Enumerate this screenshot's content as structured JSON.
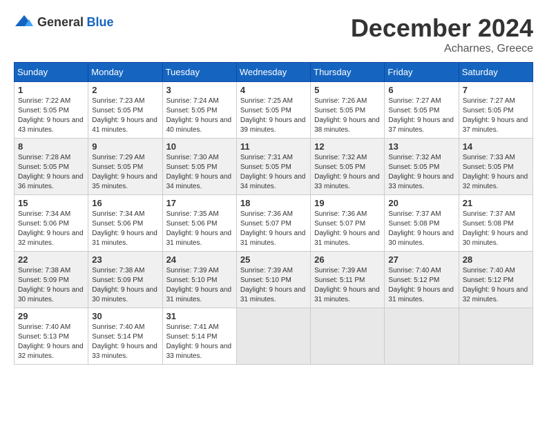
{
  "header": {
    "logo_general": "General",
    "logo_blue": "Blue",
    "month_title": "December 2024",
    "location": "Acharnes, Greece"
  },
  "columns": [
    "Sunday",
    "Monday",
    "Tuesday",
    "Wednesday",
    "Thursday",
    "Friday",
    "Saturday"
  ],
  "weeks": [
    [
      {
        "day": "1",
        "sunrise": "Sunrise: 7:22 AM",
        "sunset": "Sunset: 5:05 PM",
        "daylight": "Daylight: 9 hours and 43 minutes."
      },
      {
        "day": "2",
        "sunrise": "Sunrise: 7:23 AM",
        "sunset": "Sunset: 5:05 PM",
        "daylight": "Daylight: 9 hours and 41 minutes."
      },
      {
        "day": "3",
        "sunrise": "Sunrise: 7:24 AM",
        "sunset": "Sunset: 5:05 PM",
        "daylight": "Daylight: 9 hours and 40 minutes."
      },
      {
        "day": "4",
        "sunrise": "Sunrise: 7:25 AM",
        "sunset": "Sunset: 5:05 PM",
        "daylight": "Daylight: 9 hours and 39 minutes."
      },
      {
        "day": "5",
        "sunrise": "Sunrise: 7:26 AM",
        "sunset": "Sunset: 5:05 PM",
        "daylight": "Daylight: 9 hours and 38 minutes."
      },
      {
        "day": "6",
        "sunrise": "Sunrise: 7:27 AM",
        "sunset": "Sunset: 5:05 PM",
        "daylight": "Daylight: 9 hours and 37 minutes."
      },
      {
        "day": "7",
        "sunrise": "Sunrise: 7:27 AM",
        "sunset": "Sunset: 5:05 PM",
        "daylight": "Daylight: 9 hours and 37 minutes."
      }
    ],
    [
      {
        "day": "8",
        "sunrise": "Sunrise: 7:28 AM",
        "sunset": "Sunset: 5:05 PM",
        "daylight": "Daylight: 9 hours and 36 minutes."
      },
      {
        "day": "9",
        "sunrise": "Sunrise: 7:29 AM",
        "sunset": "Sunset: 5:05 PM",
        "daylight": "Daylight: 9 hours and 35 minutes."
      },
      {
        "day": "10",
        "sunrise": "Sunrise: 7:30 AM",
        "sunset": "Sunset: 5:05 PM",
        "daylight": "Daylight: 9 hours and 34 minutes."
      },
      {
        "day": "11",
        "sunrise": "Sunrise: 7:31 AM",
        "sunset": "Sunset: 5:05 PM",
        "daylight": "Daylight: 9 hours and 34 minutes."
      },
      {
        "day": "12",
        "sunrise": "Sunrise: 7:32 AM",
        "sunset": "Sunset: 5:05 PM",
        "daylight": "Daylight: 9 hours and 33 minutes."
      },
      {
        "day": "13",
        "sunrise": "Sunrise: 7:32 AM",
        "sunset": "Sunset: 5:05 PM",
        "daylight": "Daylight: 9 hours and 33 minutes."
      },
      {
        "day": "14",
        "sunrise": "Sunrise: 7:33 AM",
        "sunset": "Sunset: 5:05 PM",
        "daylight": "Daylight: 9 hours and 32 minutes."
      }
    ],
    [
      {
        "day": "15",
        "sunrise": "Sunrise: 7:34 AM",
        "sunset": "Sunset: 5:06 PM",
        "daylight": "Daylight: 9 hours and 32 minutes."
      },
      {
        "day": "16",
        "sunrise": "Sunrise: 7:34 AM",
        "sunset": "Sunset: 5:06 PM",
        "daylight": "Daylight: 9 hours and 31 minutes."
      },
      {
        "day": "17",
        "sunrise": "Sunrise: 7:35 AM",
        "sunset": "Sunset: 5:06 PM",
        "daylight": "Daylight: 9 hours and 31 minutes."
      },
      {
        "day": "18",
        "sunrise": "Sunrise: 7:36 AM",
        "sunset": "Sunset: 5:07 PM",
        "daylight": "Daylight: 9 hours and 31 minutes."
      },
      {
        "day": "19",
        "sunrise": "Sunrise: 7:36 AM",
        "sunset": "Sunset: 5:07 PM",
        "daylight": "Daylight: 9 hours and 31 minutes."
      },
      {
        "day": "20",
        "sunrise": "Sunrise: 7:37 AM",
        "sunset": "Sunset: 5:08 PM",
        "daylight": "Daylight: 9 hours and 30 minutes."
      },
      {
        "day": "21",
        "sunrise": "Sunrise: 7:37 AM",
        "sunset": "Sunset: 5:08 PM",
        "daylight": "Daylight: 9 hours and 30 minutes."
      }
    ],
    [
      {
        "day": "22",
        "sunrise": "Sunrise: 7:38 AM",
        "sunset": "Sunset: 5:09 PM",
        "daylight": "Daylight: 9 hours and 30 minutes."
      },
      {
        "day": "23",
        "sunrise": "Sunrise: 7:38 AM",
        "sunset": "Sunset: 5:09 PM",
        "daylight": "Daylight: 9 hours and 30 minutes."
      },
      {
        "day": "24",
        "sunrise": "Sunrise: 7:39 AM",
        "sunset": "Sunset: 5:10 PM",
        "daylight": "Daylight: 9 hours and 31 minutes."
      },
      {
        "day": "25",
        "sunrise": "Sunrise: 7:39 AM",
        "sunset": "Sunset: 5:10 PM",
        "daylight": "Daylight: 9 hours and 31 minutes."
      },
      {
        "day": "26",
        "sunrise": "Sunrise: 7:39 AM",
        "sunset": "Sunset: 5:11 PM",
        "daylight": "Daylight: 9 hours and 31 minutes."
      },
      {
        "day": "27",
        "sunrise": "Sunrise: 7:40 AM",
        "sunset": "Sunset: 5:12 PM",
        "daylight": "Daylight: 9 hours and 31 minutes."
      },
      {
        "day": "28",
        "sunrise": "Sunrise: 7:40 AM",
        "sunset": "Sunset: 5:12 PM",
        "daylight": "Daylight: 9 hours and 32 minutes."
      }
    ],
    [
      {
        "day": "29",
        "sunrise": "Sunrise: 7:40 AM",
        "sunset": "Sunset: 5:13 PM",
        "daylight": "Daylight: 9 hours and 32 minutes."
      },
      {
        "day": "30",
        "sunrise": "Sunrise: 7:40 AM",
        "sunset": "Sunset: 5:14 PM",
        "daylight": "Daylight: 9 hours and 33 minutes."
      },
      {
        "day": "31",
        "sunrise": "Sunrise: 7:41 AM",
        "sunset": "Sunset: 5:14 PM",
        "daylight": "Daylight: 9 hours and 33 minutes."
      },
      null,
      null,
      null,
      null
    ]
  ]
}
